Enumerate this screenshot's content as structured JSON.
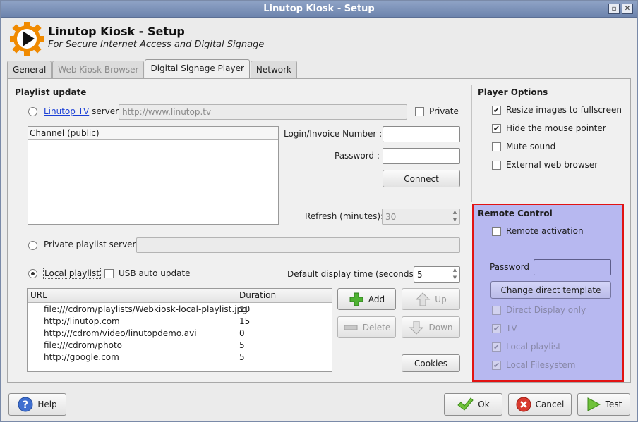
{
  "window": {
    "title": "Linutop Kiosk - Setup"
  },
  "header": {
    "title": "Linutop Kiosk - Setup",
    "subtitle": "For Secure Internet Access and Digital Signage"
  },
  "tabs": [
    {
      "label": "General",
      "state": "normal"
    },
    {
      "label": "Web Kiosk Browser",
      "state": "disabled"
    },
    {
      "label": "Digital Signage Player",
      "state": "active"
    },
    {
      "label": "Network",
      "state": "normal"
    }
  ],
  "playlist": {
    "title": "Playlist update",
    "linutop_link": "Linutop TV",
    "server_label": " server",
    "server_url": "http://www.linutop.tv",
    "private_label": "Private",
    "channel_header": "Channel (public)",
    "login_label": "Login/Invoice Number :",
    "login_value": "",
    "password_label": "Password :",
    "password_value": "",
    "connect_label": "Connect",
    "refresh_label": "Refresh (minutes):",
    "refresh_value": "30",
    "private_server_label": "Private playlist server",
    "private_server_value": "",
    "local_playlist_label": "Local playlist",
    "usb_label": "USB auto update",
    "default_time_label": "Default display time (seconds):",
    "default_time_value": "5",
    "col_url": "URL",
    "col_duration": "Duration",
    "rows": [
      {
        "url": "file:///cdrom/playlists/Webkiosk-local-playlist.jpg",
        "duration": "10"
      },
      {
        "url": "http://linutop.com",
        "duration": "15"
      },
      {
        "url": "http:///cdrom/video/linutopdemo.avi",
        "duration": "0"
      },
      {
        "url": "file:///cdrom/photo",
        "duration": "5"
      },
      {
        "url": "http://google.com",
        "duration": "5"
      }
    ],
    "add_label": "Add",
    "up_label": "Up",
    "delete_label": "Delete",
    "down_label": "Down",
    "cookies_label": "Cookies"
  },
  "player": {
    "title": "Player Options",
    "options": [
      {
        "label": "Resize images to fullscreen",
        "checked": true
      },
      {
        "label": "Hide the mouse pointer",
        "checked": true
      },
      {
        "label": "Mute sound",
        "checked": false
      },
      {
        "label": "External web browser",
        "checked": false
      }
    ]
  },
  "remote": {
    "title": "Remote Control",
    "activation_label": "Remote activation",
    "password_label": "Password",
    "password_value": "",
    "template_label": "Change direct template",
    "disabled_options": [
      {
        "label": "Direct Display only",
        "checked": false
      },
      {
        "label": "TV",
        "checked": true
      },
      {
        "label": "Local playlist",
        "checked": true
      },
      {
        "label": "Local Filesystem",
        "checked": true
      }
    ]
  },
  "footer": {
    "help": "Help",
    "ok": "Ok",
    "cancel": "Cancel",
    "test": "Test"
  },
  "colors": {
    "accent": "#f08a00",
    "highlight": "#e21313",
    "panel": "#b7b8f0"
  }
}
